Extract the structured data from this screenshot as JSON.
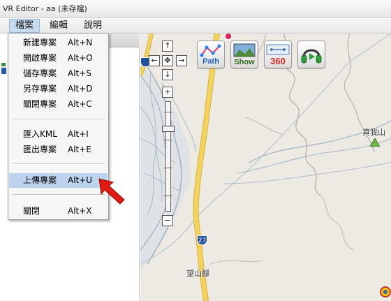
{
  "window": {
    "title": "VR Editor - aa (未存檔)"
  },
  "menubar": {
    "items": [
      {
        "label": "檔案"
      },
      {
        "label": "編輯"
      },
      {
        "label": "說明"
      }
    ]
  },
  "file_menu": {
    "groups": [
      [
        {
          "label": "新建專案",
          "shortcut": "Alt+N"
        },
        {
          "label": "開啟專案",
          "shortcut": "Alt+O"
        },
        {
          "label": "儲存專案",
          "shortcut": "Alt+S"
        },
        {
          "label": "另存專案",
          "shortcut": "Alt+D"
        },
        {
          "label": "關閉專案",
          "shortcut": "Alt+C"
        }
      ],
      [
        {
          "label": "匯入KML",
          "shortcut": "Alt+I"
        },
        {
          "label": "匯出專案",
          "shortcut": "Alt+E"
        }
      ],
      [
        {
          "label": "上傳專案",
          "shortcut": "Alt+U",
          "selected": true
        }
      ],
      [
        {
          "label": "關閉",
          "shortcut": "Alt+X"
        }
      ]
    ]
  },
  "map": {
    "nav": {
      "up": "↑",
      "down": "↓",
      "left": "←",
      "right": "→",
      "center": "✥",
      "zoom_in": "+",
      "zoom_out": "−"
    },
    "toolbar": {
      "path_label": "Path",
      "show_label": "Show",
      "pano_label": "360",
      "audio_icon": "headphones-icon"
    },
    "labels": {
      "mountain": "真我山",
      "place": "望山腳",
      "route_number": "27"
    },
    "colors": {
      "background": "#edeae4",
      "road": "#f3d35e",
      "road_border": "#d9b43a",
      "river": "#aab9c8",
      "trail": "#b5aa9c"
    }
  },
  "annotation": {
    "arrow_color": "#e11b12"
  }
}
